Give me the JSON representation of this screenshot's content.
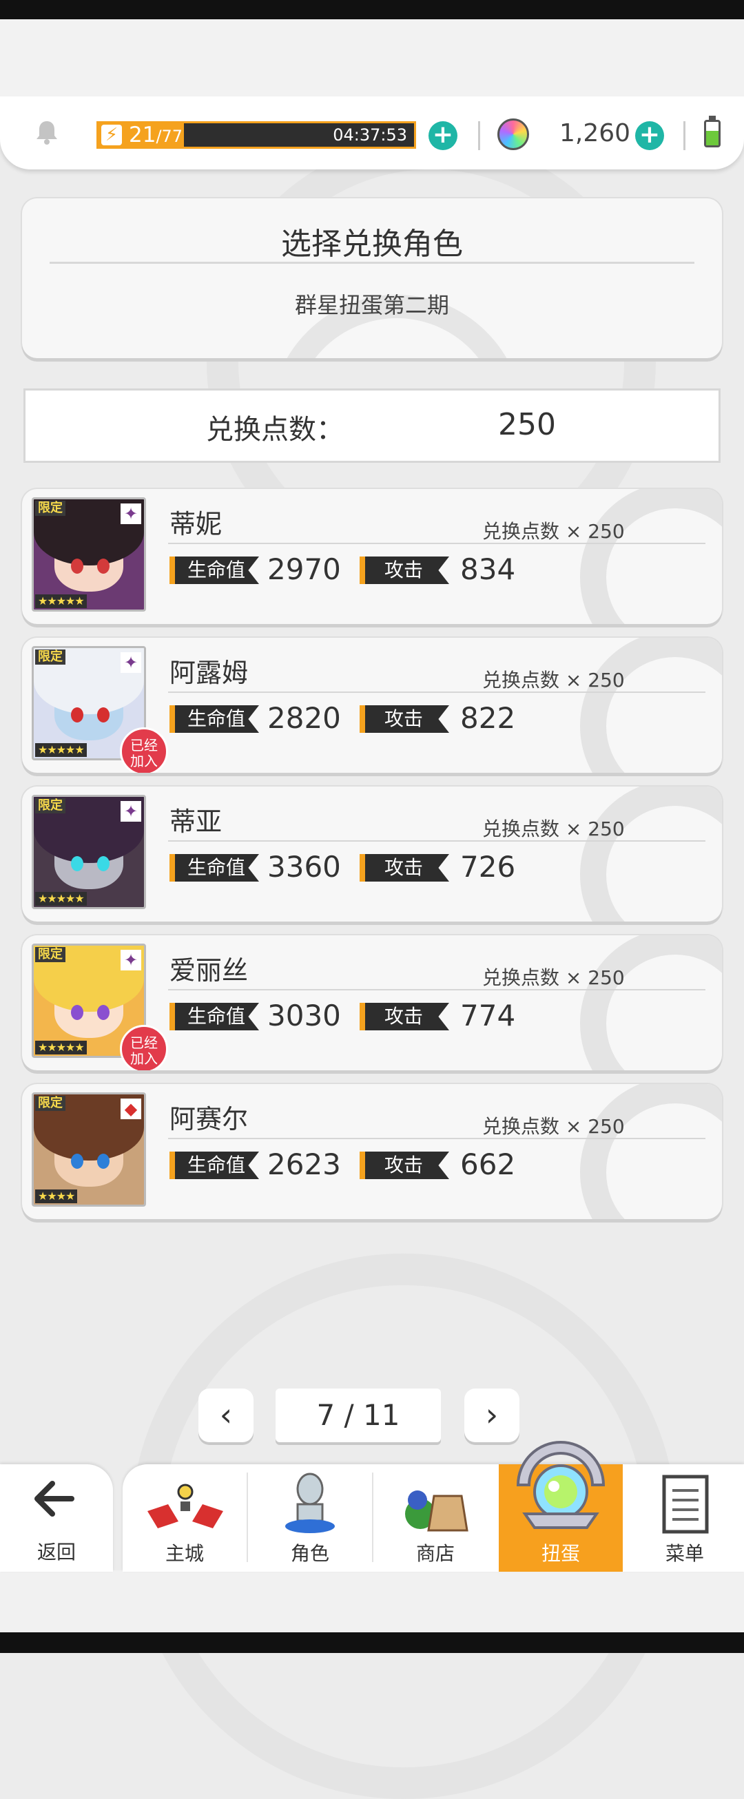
{
  "resources": {
    "stamina_current": "21",
    "stamina_max": "/77",
    "stamina_fraction": 0.27,
    "stamina_timer": "04:37:53",
    "gems": "1,260"
  },
  "header": {
    "title": "选择兑换角色",
    "subtitle": "群星扭蛋第二期"
  },
  "points": {
    "label": "兑换点数：",
    "value": "250"
  },
  "labels": {
    "hp": "生命值",
    "atk": "攻击",
    "limited": "限定",
    "joined": "已经加入",
    "cost_prefix": "兑换点数 × "
  },
  "characters": [
    {
      "name": "蒂妮",
      "cost": "250",
      "hp": "2970",
      "atk": "834",
      "stars": "★★★★★",
      "joined": false,
      "element": "dark",
      "hair": "#2b1f24",
      "skin": "#f6d7c7",
      "eye": "#d33b3b",
      "bg": "#6b3a72"
    },
    {
      "name": "阿露姆",
      "cost": "250",
      "hp": "2820",
      "atk": "822",
      "stars": "★★★★★",
      "joined": true,
      "element": "dark",
      "hair": "#eef1f6",
      "skin": "#b9d6ef",
      "eye": "#d62f2f",
      "bg": "#d9def0"
    },
    {
      "name": "蒂亚",
      "cost": "250",
      "hp": "3360",
      "atk": "726",
      "stars": "★★★★★",
      "joined": false,
      "element": "dark",
      "hair": "#3a2640",
      "skin": "#b9b9c4",
      "eye": "#3ad9e6",
      "bg": "#4a3a4a"
    },
    {
      "name": "爱丽丝",
      "cost": "250",
      "hp": "3030",
      "atk": "774",
      "stars": "★★★★★",
      "joined": true,
      "element": "dark",
      "hair": "#f5cf4a",
      "skin": "#fbe1cd",
      "eye": "#8a4fd0",
      "bg": "#f3b64c"
    },
    {
      "name": "阿赛尔",
      "cost": "250",
      "hp": "2623",
      "atk": "662",
      "stars": "★★★★",
      "joined": false,
      "element": "fire",
      "hair": "#6b3c25",
      "skin": "#f2d0b4",
      "eye": "#2d7fd8",
      "bg": "#c9a27a"
    }
  ],
  "pager": {
    "current": "7",
    "total": "11",
    "display": "7 / 11"
  },
  "nav": {
    "back": "返回",
    "items": [
      "主城",
      "角色",
      "商店",
      "扭蛋",
      "菜单"
    ],
    "active": "扭蛋"
  },
  "colors": {
    "accent": "#f7a01e",
    "teal": "#1fb6a6",
    "badge_red": "#e23b4b"
  }
}
